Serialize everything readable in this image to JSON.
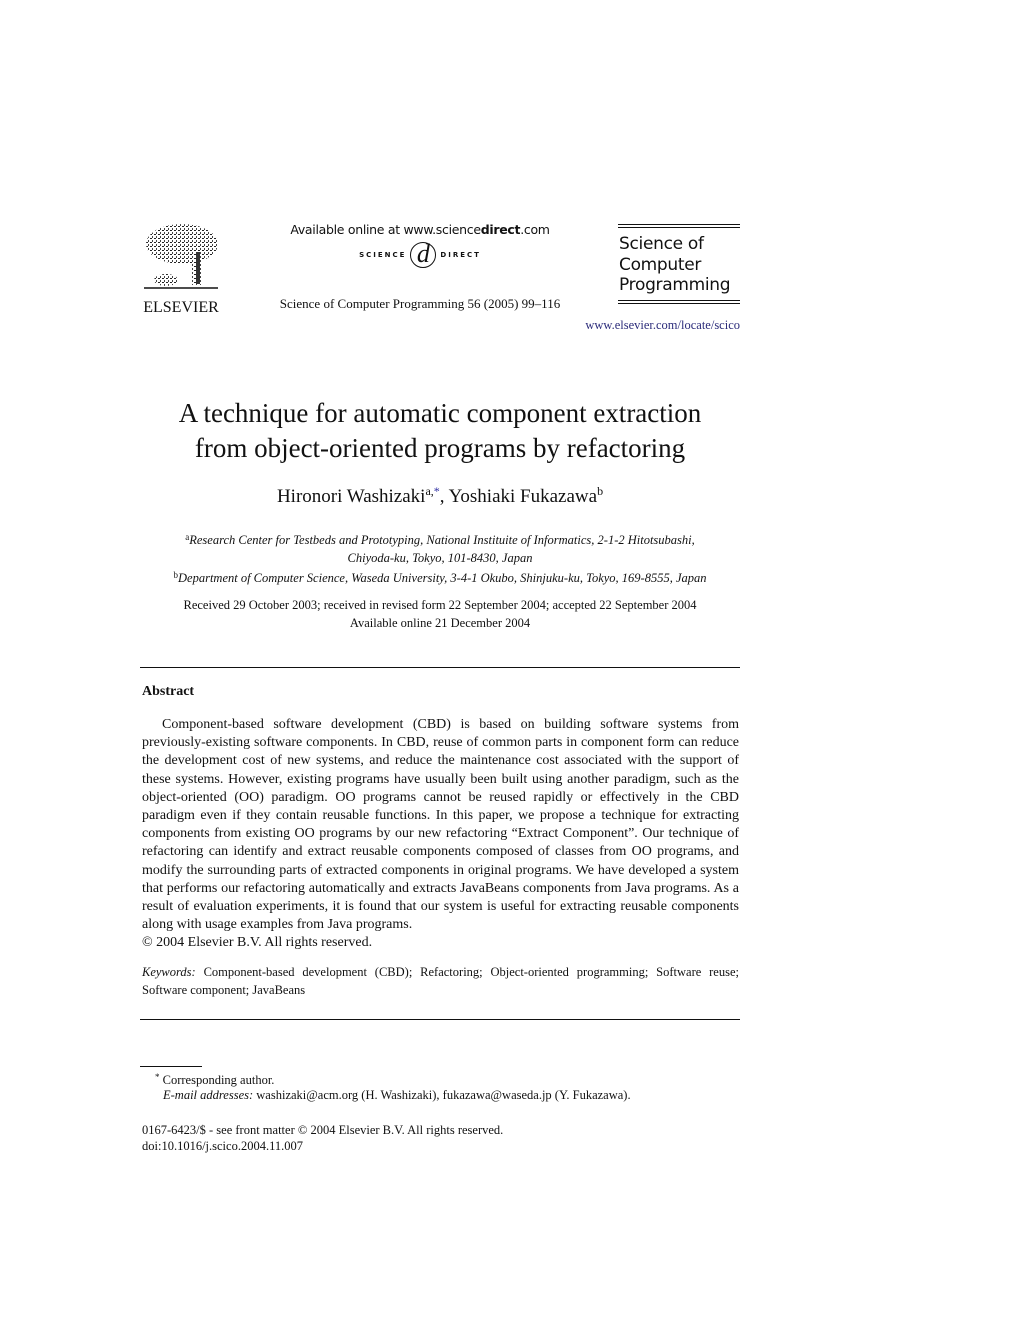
{
  "header": {
    "publisher_logo_label": "ELSEVIER",
    "publisher_logo_icon": "elsevier-tree-icon",
    "available_online_prefix": "Available online at www.science",
    "available_online_bold": "direct",
    "available_online_suffix": ".com",
    "sciencedirect_left": "SCIENCE",
    "sciencedirect_d": "d",
    "sciencedirect_right": "DIRECT",
    "journal_reference": "Science of Computer Programming 56 (2005) 99–116",
    "journal_name_line1": "Science of",
    "journal_name_line2": "Computer",
    "journal_name_line3": "Programming",
    "journal_url": "www.elsevier.com/locate/scico"
  },
  "article": {
    "title_line1": "A technique for automatic component extraction",
    "title_line2": "from object-oriented programs by refactoring",
    "authors": [
      {
        "name": "Hironori Washizaki",
        "sup_aff": "a,",
        "sup_star": "*"
      },
      {
        "name": "Yoshiaki Fukazawa",
        "sup_aff": "b"
      }
    ],
    "author_separator": ", ",
    "affiliations": [
      {
        "label": "a",
        "line1": "Research Center for Testbeds and Prototyping, National Instituite of Informatics, 2-1-2 Hitotsubashi,",
        "line2": "Chiyoda-ku, Tokyo, 101-8430, Japan"
      },
      {
        "label": "b",
        "line1": "Department of Computer Science, Waseda University, 3-4-1 Okubo, Shinjuku-ku, Tokyo, 169-8555, Japan"
      }
    ],
    "dates_line1": "Received 29 October 2003; received in revised form 22 September 2004; accepted 22 September 2004",
    "dates_line2": "Available online 21 December 2004"
  },
  "abstract": {
    "heading": "Abstract",
    "body": "Component-based software development (CBD) is based on building software systems from previously-existing software components. In CBD, reuse of common parts in component form can reduce the development cost of new systems, and reduce the maintenance cost associated with the support of these systems. However, existing programs have usually been built using another paradigm, such as the object-oriented (OO) paradigm. OO programs cannot be reused rapidly or effectively in the CBD paradigm even if they contain reusable functions. In this paper, we propose a technique for extracting components from existing OO programs by our new refactoring “Extract Component”. Our technique of refactoring can identify and extract reusable components composed of classes from OO programs, and modify the surrounding parts of extracted components in original programs. We have developed a system that performs our refactoring automatically and extracts JavaBeans components from Java programs. As a result of evaluation experiments, it is found that our system is useful for extracting reusable components along with usage examples from Java programs.",
    "copyright": "© 2004 Elsevier B.V. All rights reserved.",
    "keywords_label": "Keywords:",
    "keywords": "Component-based development (CBD); Refactoring; Object-oriented programming; Software reuse; Software component; JavaBeans"
  },
  "footnotes": {
    "star": "*",
    "corresponding": "Corresponding author.",
    "email_label": "E-mail addresses:",
    "emails": "washizaki@acm.org (H. Washizaki), fukazawa@waseda.jp (Y. Fukazawa)."
  },
  "footer": {
    "issn": "0167-6423/$ - see front matter © 2004 Elsevier B.V. All rights reserved.",
    "doi": "doi:10.1016/j.scico.2004.11.007"
  }
}
